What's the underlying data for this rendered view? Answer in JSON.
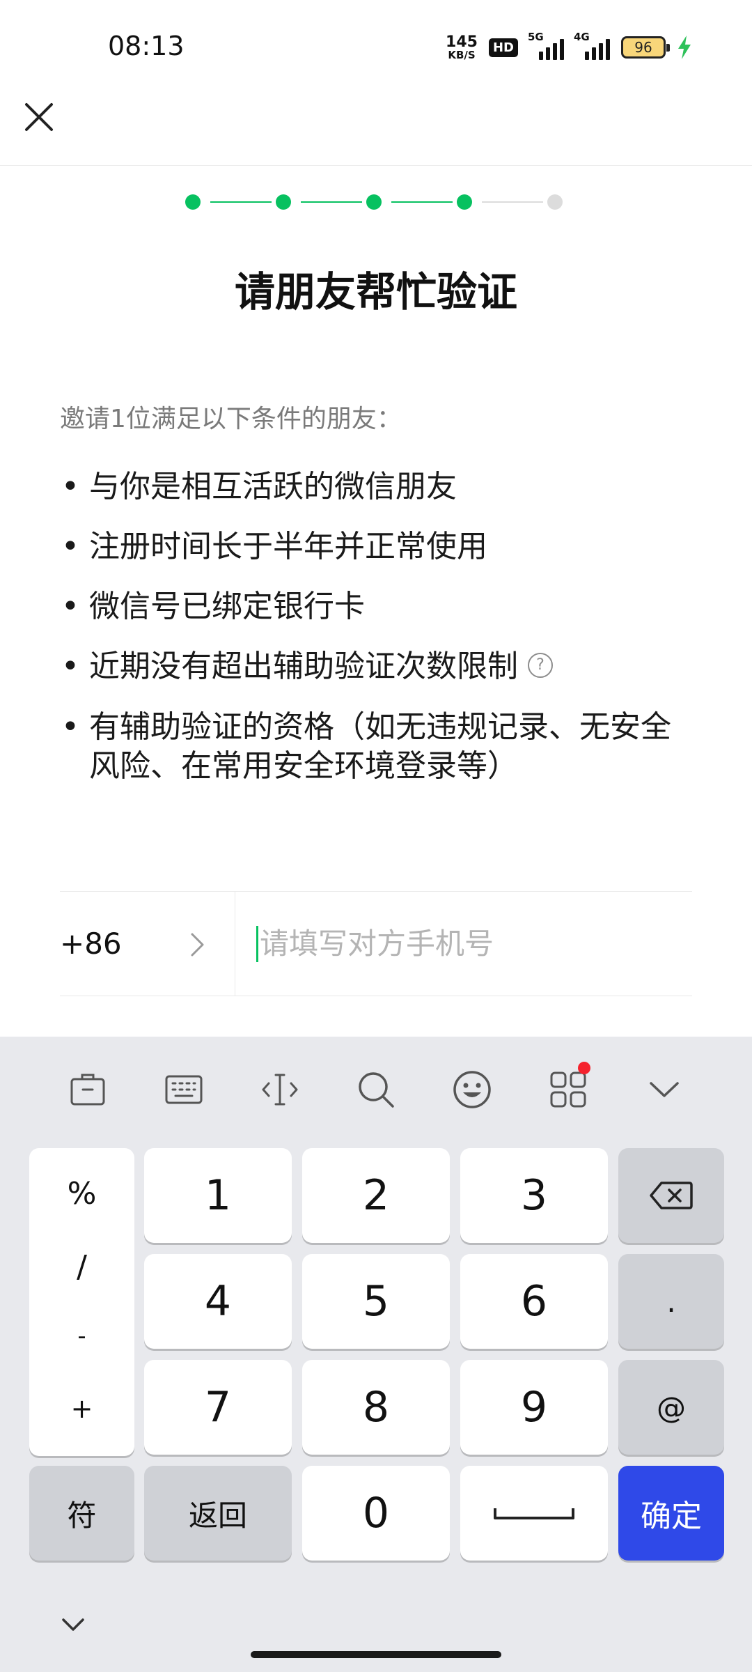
{
  "status_bar": {
    "time": "08:13",
    "net_speed": "145",
    "net_unit": "KB/S",
    "hd_label": "HD",
    "sig1_label": "5G",
    "sig2_label": "4G",
    "battery": "96"
  },
  "header": {
    "close_icon": "close-icon"
  },
  "stepper": {
    "total_steps": 5,
    "current_step": 4
  },
  "page": {
    "title": "请朋友帮忙验证",
    "intro": "邀请1位满足以下条件的朋友：",
    "bullet": "•",
    "conditions": [
      "与你是相互活跃的微信朋友",
      "注册时间长于半年并正常使用",
      "微信号已绑定银行卡",
      "近期没有超出辅助验证次数限制",
      "有辅助验证的资格（如无违规记录、无安全风险、在常用安全环境登录等）"
    ],
    "help_mark": "?"
  },
  "phone": {
    "country_code": "+86",
    "placeholder": "请填写对方手机号"
  },
  "keyboard": {
    "symbols": [
      "%",
      "/",
      "-",
      "+"
    ],
    "digits": [
      "1",
      "2",
      "3",
      "4",
      "5",
      "6",
      "7",
      "8",
      "9",
      "0"
    ],
    "dot_key": ".",
    "at_key": "@",
    "symbol_switch": "符",
    "back_key": "返回",
    "confirm_key": "确定",
    "accent_color": "#2f49e8",
    "brand_green": "#07c160"
  }
}
